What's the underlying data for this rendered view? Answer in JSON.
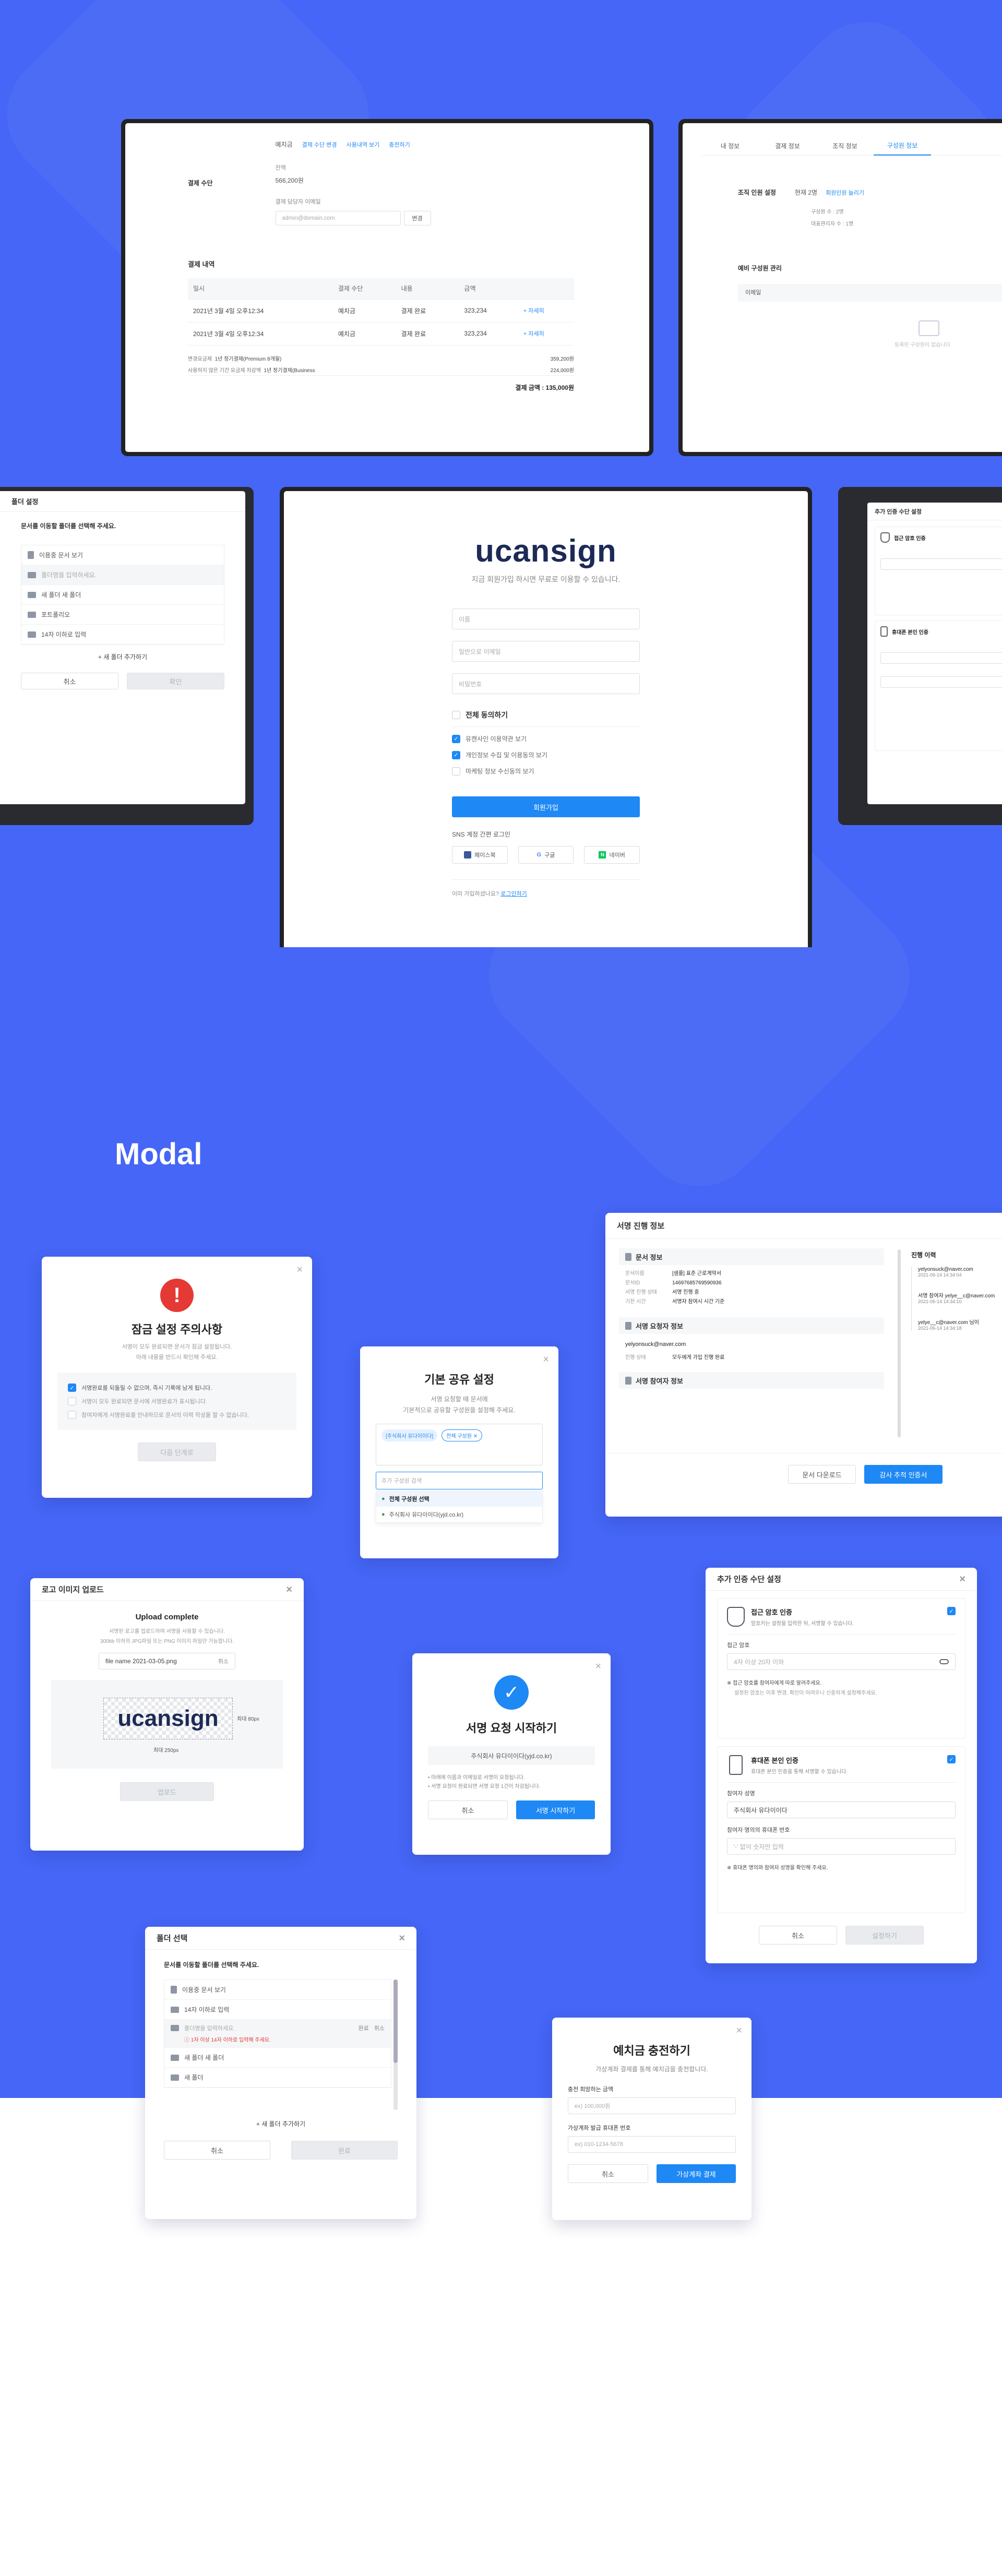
{
  "payment": {
    "method_label": "결제 수단",
    "method_value": "예치금",
    "links": [
      "결제 수단 변경",
      "사용내역 보기",
      "충전하기"
    ],
    "balance_label": "잔액",
    "balance_value": "566,200원",
    "email_label": "결제 담당자 이메일",
    "email_placeholder": "admin@domain.com",
    "change_button": "변경",
    "history_title": "결제 내역",
    "columns": [
      "일시",
      "결제 수단",
      "내용",
      "금액"
    ],
    "rows": [
      {
        "date": "2021년 3월 4일 오후12:34",
        "method": "예치금",
        "content": "결제 완료",
        "amount": "323,234",
        "detail": "자세히"
      },
      {
        "date": "2021년 3월 4일 오후12:34",
        "method": "예치금",
        "content": "결제 완료",
        "amount": "323,234",
        "detail": "자세히"
      }
    ],
    "items": [
      {
        "label": "변경요금제",
        "value": "1년 정기결제(Premium 8개월)",
        "amount": "359,200원"
      },
      {
        "label": "사용하지 않은 기간 요금제 차감액",
        "value": "1년 정기결제(Business",
        "amount": "224,000원"
      }
    ],
    "total": "결제 금액 : 135,000원"
  },
  "org": {
    "tabs": [
      "내 정보",
      "결제 정보",
      "조직 정보",
      "구성원 정보"
    ],
    "setting_label": "조직 인원 설정",
    "setting_value": "현재 2명",
    "history_link": "회원인원 늘리기",
    "counts": [
      "구성원 수 : 2명",
      "대표관리자 수 : 1명"
    ],
    "manage_label": "예비 구성원 관리",
    "email_col": "이메일",
    "empty": "등록된 구성원이 없습니다"
  },
  "folder_small": {
    "title": "폴더 설정",
    "desc": "문서를 이동할 폴더를 선택해 주세요.",
    "items": [
      "이용중 문서 보기",
      "폴더명을 입력하세요.",
      "새 폴더 새 폴더",
      "포트폴리오",
      "14자 이하로 입력"
    ],
    "add": "새 폴더 추가하기",
    "cancel": "취소",
    "confirm": "확인"
  },
  "signup": {
    "logo": "ucansign",
    "subtitle": "지금 회원가입 하시면 무료로 이용할 수 있습니다.",
    "placeholders": [
      "이름",
      "일반으로 이메일",
      "비밀번호"
    ],
    "agree_all": "전체 동의하기",
    "terms": [
      "유캔사인 이용약관 보기",
      "개인정보 수집 및 이용동의 보기",
      "마케팅 정보 수신동의 보기"
    ],
    "submit": "회원가입",
    "sns_label": "SNS 계정 간편 로그인",
    "sns": [
      "페이스북",
      "구글",
      "네이버"
    ],
    "login_prompt": "이미 가입하셨나요?",
    "login_link": "로그인하기"
  },
  "auth_small": {
    "title": "추가 인증 수단 설정",
    "item1": "접근 암호 인증",
    "item2": "휴대폰 본인 인증"
  },
  "section_title": "Modal",
  "lock": {
    "title": "잠금 설정 주의사항",
    "desc1": "서명이 모두 완료되면 문서가 잠금 설정됩니다.",
    "desc2": "아래 내용을 반드시 확인해 주세요.",
    "checks": [
      "서명완료를 되돌릴 수 없으며, 즉시 기록에 남게 됩니다.",
      "서명이 모두 완료되면 문서에 서명완료가 표시됩니다.",
      "참여자에게 서명완료를 안내하므로 문서의 이력 작성을 할 수 없습니다."
    ],
    "next": "다음 단계로"
  },
  "share": {
    "title": "기본 공유 설정",
    "desc1": "서명 요청할 때 문서에",
    "desc2": "기본적으로 공유할 구성원을 설정해 주세요.",
    "tags": [
      "[주식회사 유다이이다]",
      "전체 구성원"
    ],
    "input_placeholder": "추가 구성원 검색",
    "options": [
      "전체 구성원 선택",
      "주식회사 유다이이다(yjd.co.kr)"
    ]
  },
  "progress": {
    "title": "서명 진행 정보",
    "doc_section": "문서 정보",
    "doc_rows": [
      {
        "k": "문서이름",
        "v": "[샘플] 표준 근로계약서"
      },
      {
        "k": "문서ID",
        "v": "14697685769590936"
      },
      {
        "k": "서명 진행 상태",
        "v": "서명 진행 중"
      },
      {
        "k": "기한 시간",
        "v": "서명자 참여시 시간 기준"
      }
    ],
    "req_section": "서명 요청자 정보",
    "req_email": "yelyonsuck@naver.com",
    "req_row": {
      "k": "진행 상태",
      "v": "모두에게 가입 진행 완료"
    },
    "part_section": "서명 참여자 정보",
    "history_title": "진행 이력",
    "history": [
      {
        "name": "yelyonsuck@naver.com",
        "time": "2021-06-14 14:34:04"
      },
      {
        "name": "서명 참여자 yelye__c@naver.com",
        "time": "2021-06-14 14:34:10"
      },
      {
        "name": "yelye__c@naver.com 님이",
        "time": "2021-06-14 14:34:18"
      }
    ],
    "download": "문서 다운로드",
    "audit": "감사 추적 인증서"
  },
  "logo_upload": {
    "title": "로고 이미지 업로드",
    "status": "Upload complete",
    "desc1": "서명된 로고를 업로드하여 서명을 사용할 수 있습니다.",
    "desc2": "300kb 이하의 JPG파일 또는 PNG 이미지 파일만 가능합니다.",
    "file": "file name 2021-03-05.png",
    "delete": "취소",
    "logo": "ucansign",
    "h": "최대 80px",
    "w": "최대 250px",
    "upload": "업로드"
  },
  "start": {
    "title": "서명 요청 시작하기",
    "company": "주식회사 유다이이다(yjd.co.kr)",
    "notes": [
      "마래에 이름과 이메일로 서명이 요청됩니다.",
      "서명 요청이 완료되면 서명 요청 1건이 차감됩니다."
    ],
    "cancel": "취소",
    "start": "서명 시작하기"
  },
  "auth": {
    "title": "추가 인증 수단 설정",
    "m1_title": "접근 암호 인증",
    "m1_desc": "암호키는 설정을 입력한 뒤, 서명할 수 있습니다.",
    "pw_label": "접근 암호",
    "pw_placeholder": "4자 이상 20자 이하",
    "m1_note": "접근 암호를 참여자에게 따로 알려주세요.",
    "m1_note2": "설정된 암호는 이후 변경, 확인이 어려우니 신중하게 설정해주세요.",
    "m2_title": "휴대폰 본인 인증",
    "m2_desc": "휴대폰 본인 인증을 통해 서명할 수 있습니다.",
    "name_label": "참여자 성명",
    "name_value": "주식회사 유다이이다",
    "phone_label": "참여자 명의의 휴대폰 번호",
    "phone_placeholder": "'-' 없이 숫자만 입력",
    "m2_note": "휴대폰 명의와 참여자 성명을 확인해 주세요.",
    "cancel": "취소",
    "confirm": "설정하기"
  },
  "folder": {
    "title": "폴더 선택",
    "desc": "문서를 이동할 폴더를 선택해 주세요.",
    "items": [
      "이용중 문서 보기",
      "14자 이하로 입력",
      "폴더명을 입력하세요.",
      "새 폴더 새 폴더",
      "새 폴더"
    ],
    "error": "1자 이상 14자 이하로 입력해 주세요.",
    "item_actions": [
      "완료",
      "취소"
    ],
    "add": "새 폴더 추가하기",
    "cancel": "취소",
    "confirm": "완료"
  },
  "charge": {
    "title": "예치금 충전하기",
    "desc": "가상계좌 결제를 통해 예치금을 충전합니다.",
    "amount_label": "충전 희망하는 금액",
    "amount_placeholder": "ex) 100,000원",
    "phone_label": "가상계좌 발급 휴대폰 번호",
    "phone_placeholder": "ex) 010-1234-5678",
    "cancel": "취소",
    "pay": "가상계좌 결제"
  },
  "colors": {
    "bg": "#4566f6",
    "primary": "#1e88f5",
    "error": "#e53935"
  }
}
